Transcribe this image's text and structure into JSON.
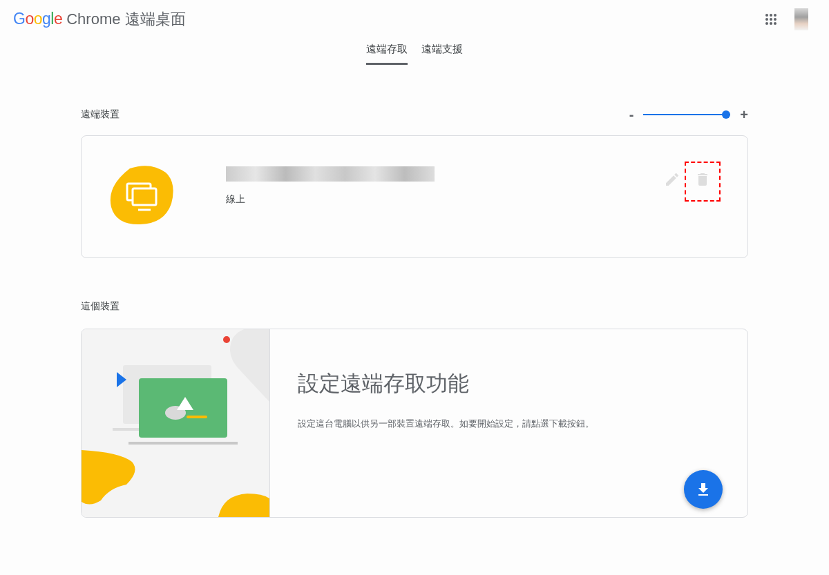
{
  "header": {
    "brand": "Google",
    "product": "Chrome 遠端桌面"
  },
  "tabs": [
    {
      "label": "遠端存取",
      "selected": true
    },
    {
      "label": "遠端支援",
      "selected": false
    }
  ],
  "remote_devices": {
    "title": "遠端裝置",
    "zoom": {
      "minus": "-",
      "plus": "+",
      "level": 1.0
    },
    "devices": [
      {
        "status": "線上",
        "delete_highlighted": true
      }
    ]
  },
  "this_device": {
    "title": "這個裝置",
    "heading": "設定遠端存取功能",
    "description": "設定這台電腦以供另一部裝置遠端存取。如要開始設定，請點選下載按鈕。"
  }
}
